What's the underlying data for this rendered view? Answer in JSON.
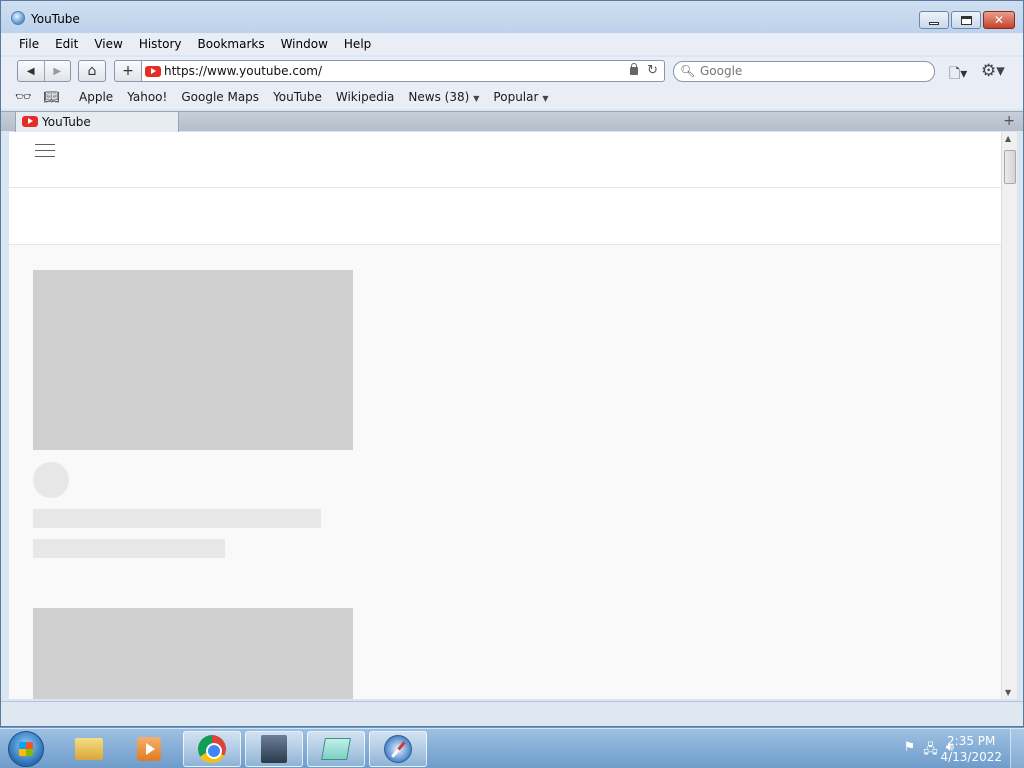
{
  "window": {
    "title": "YouTube"
  },
  "menubar": {
    "items": [
      "File",
      "Edit",
      "View",
      "History",
      "Bookmarks",
      "Window",
      "Help"
    ]
  },
  "toolbar": {
    "url": "https://www.youtube.com/",
    "search_placeholder": "Google"
  },
  "bookmarks": {
    "items": [
      "Apple",
      "Yahoo!",
      "Google Maps",
      "YouTube",
      "Wikipedia"
    ],
    "news_label": "News (38)",
    "popular_label": "Popular"
  },
  "tabs": [
    {
      "label": "YouTube"
    }
  ],
  "taskbar": {
    "time": "2:35 PM",
    "date": "4/13/2022"
  },
  "colors": {
    "youtube_red": "#e52d27",
    "skeleton": "#cfcfcf",
    "skeleton_light": "#e7e7e7"
  }
}
